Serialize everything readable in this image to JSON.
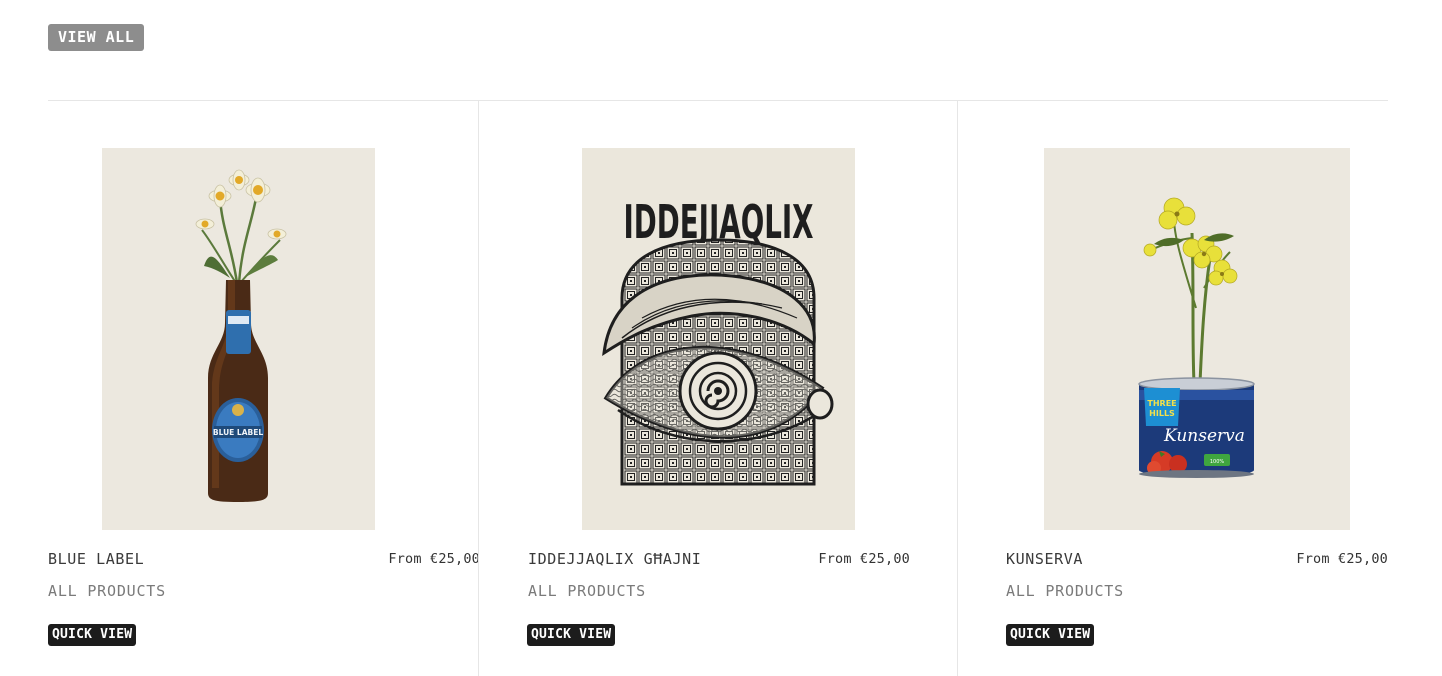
{
  "header": {
    "view_all_label": "VIEW ALL"
  },
  "products": [
    {
      "title": "BLUE LABEL",
      "price": "From €25,00",
      "category": "ALL PRODUCTS",
      "quick_view_label": "QUICK VIEW",
      "image_icon": "beer-bottle-with-daffodils"
    },
    {
      "title": "IDDEJJAQLIX GĦAJNI",
      "price": "From €25,00",
      "category": "ALL PRODUCTS",
      "quick_view_label": "QUICK VIEW",
      "image_icon": "engraved-eye-poster",
      "poster_text": "IDDEJJAQLIX"
    },
    {
      "title": "KUNSERVA",
      "price": "From €25,00",
      "category": "ALL PRODUCTS",
      "quick_view_label": "QUICK VIEW",
      "image_icon": "tomato-can-with-yellow-flowers",
      "can_brand_text": "THREE HILLS",
      "can_script_text": "Kunserva"
    }
  ],
  "colors": {
    "view_all_bg": "#8d8d8d",
    "quick_view_bg": "#1c1c1c",
    "image_paper": "#ece8df",
    "divider": "#e6e6e6"
  }
}
